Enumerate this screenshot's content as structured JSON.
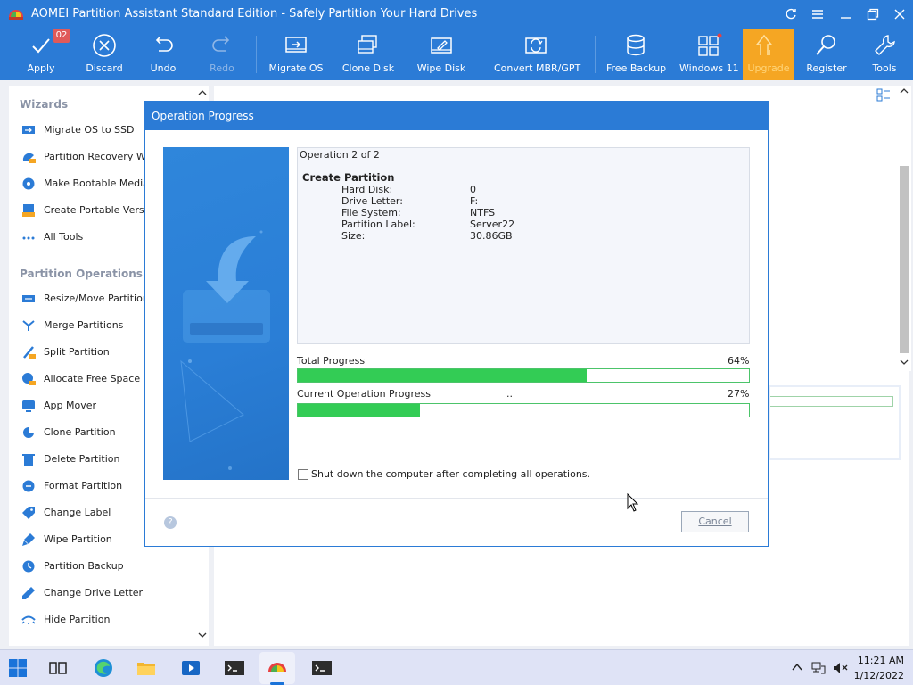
{
  "window": {
    "title": "AOMEI Partition Assistant Standard Edition - Safely Partition Your Hard Drives"
  },
  "toolbar": {
    "apply": "Apply",
    "apply_badge": "02",
    "discard": "Discard",
    "undo": "Undo",
    "redo": "Redo",
    "migrate_os": "Migrate OS",
    "clone_disk": "Clone Disk",
    "wipe_disk": "Wipe Disk",
    "convert": "Convert MBR/GPT",
    "free_backup": "Free Backup",
    "windows11": "Windows 11",
    "upgrade": "Upgrade",
    "register": "Register",
    "tools": "Tools"
  },
  "sidebar": {
    "wizards_title": "Wizards",
    "wizards": [
      {
        "label": "Migrate OS to SSD"
      },
      {
        "label": "Partition Recovery Wiza"
      },
      {
        "label": "Make Bootable Media"
      },
      {
        "label": "Create Portable Version"
      },
      {
        "label": "All Tools"
      }
    ],
    "ops_title": "Partition Operations",
    "ops": [
      {
        "label": "Resize/Move Partition"
      },
      {
        "label": "Merge Partitions"
      },
      {
        "label": "Split Partition"
      },
      {
        "label": "Allocate Free Space"
      },
      {
        "label": "App Mover"
      },
      {
        "label": "Clone Partition"
      },
      {
        "label": "Delete Partition"
      },
      {
        "label": "Format Partition"
      },
      {
        "label": "Change Label"
      },
      {
        "label": "Wipe Partition"
      },
      {
        "label": "Partition Backup"
      },
      {
        "label": "Change Drive Letter"
      },
      {
        "label": "Hide Partition"
      }
    ]
  },
  "dialog": {
    "title": "Operation Progress",
    "operation_count": "Operation 2 of 2",
    "operation_name": "Create Partition",
    "details": [
      {
        "key": "Hard Disk:",
        "value": "0"
      },
      {
        "key": "Drive Letter:",
        "value": "F:"
      },
      {
        "key": "File System:",
        "value": "NTFS"
      },
      {
        "key": "Partition Label:",
        "value": "Server22"
      },
      {
        "key": "Size:",
        "value": "30.86GB"
      }
    ],
    "total_label": "Total Progress",
    "total_percent_text": "64%",
    "total_fraction": 0.64,
    "current_label": "Current Operation Progress",
    "current_dots": "..",
    "current_percent_text": "27%",
    "current_fraction": 0.27,
    "shutdown_label": "Shut down the computer after completing all operations.",
    "shutdown_checked": false,
    "cancel": "Cancel",
    "help": "?"
  },
  "taskbar": {
    "time": "11:21 AM",
    "date": "1/12/2022"
  },
  "colors": {
    "brand_blue": "#2b7bd6",
    "progress_green": "#33cc55",
    "upgrade_orange": "#f5a623"
  }
}
